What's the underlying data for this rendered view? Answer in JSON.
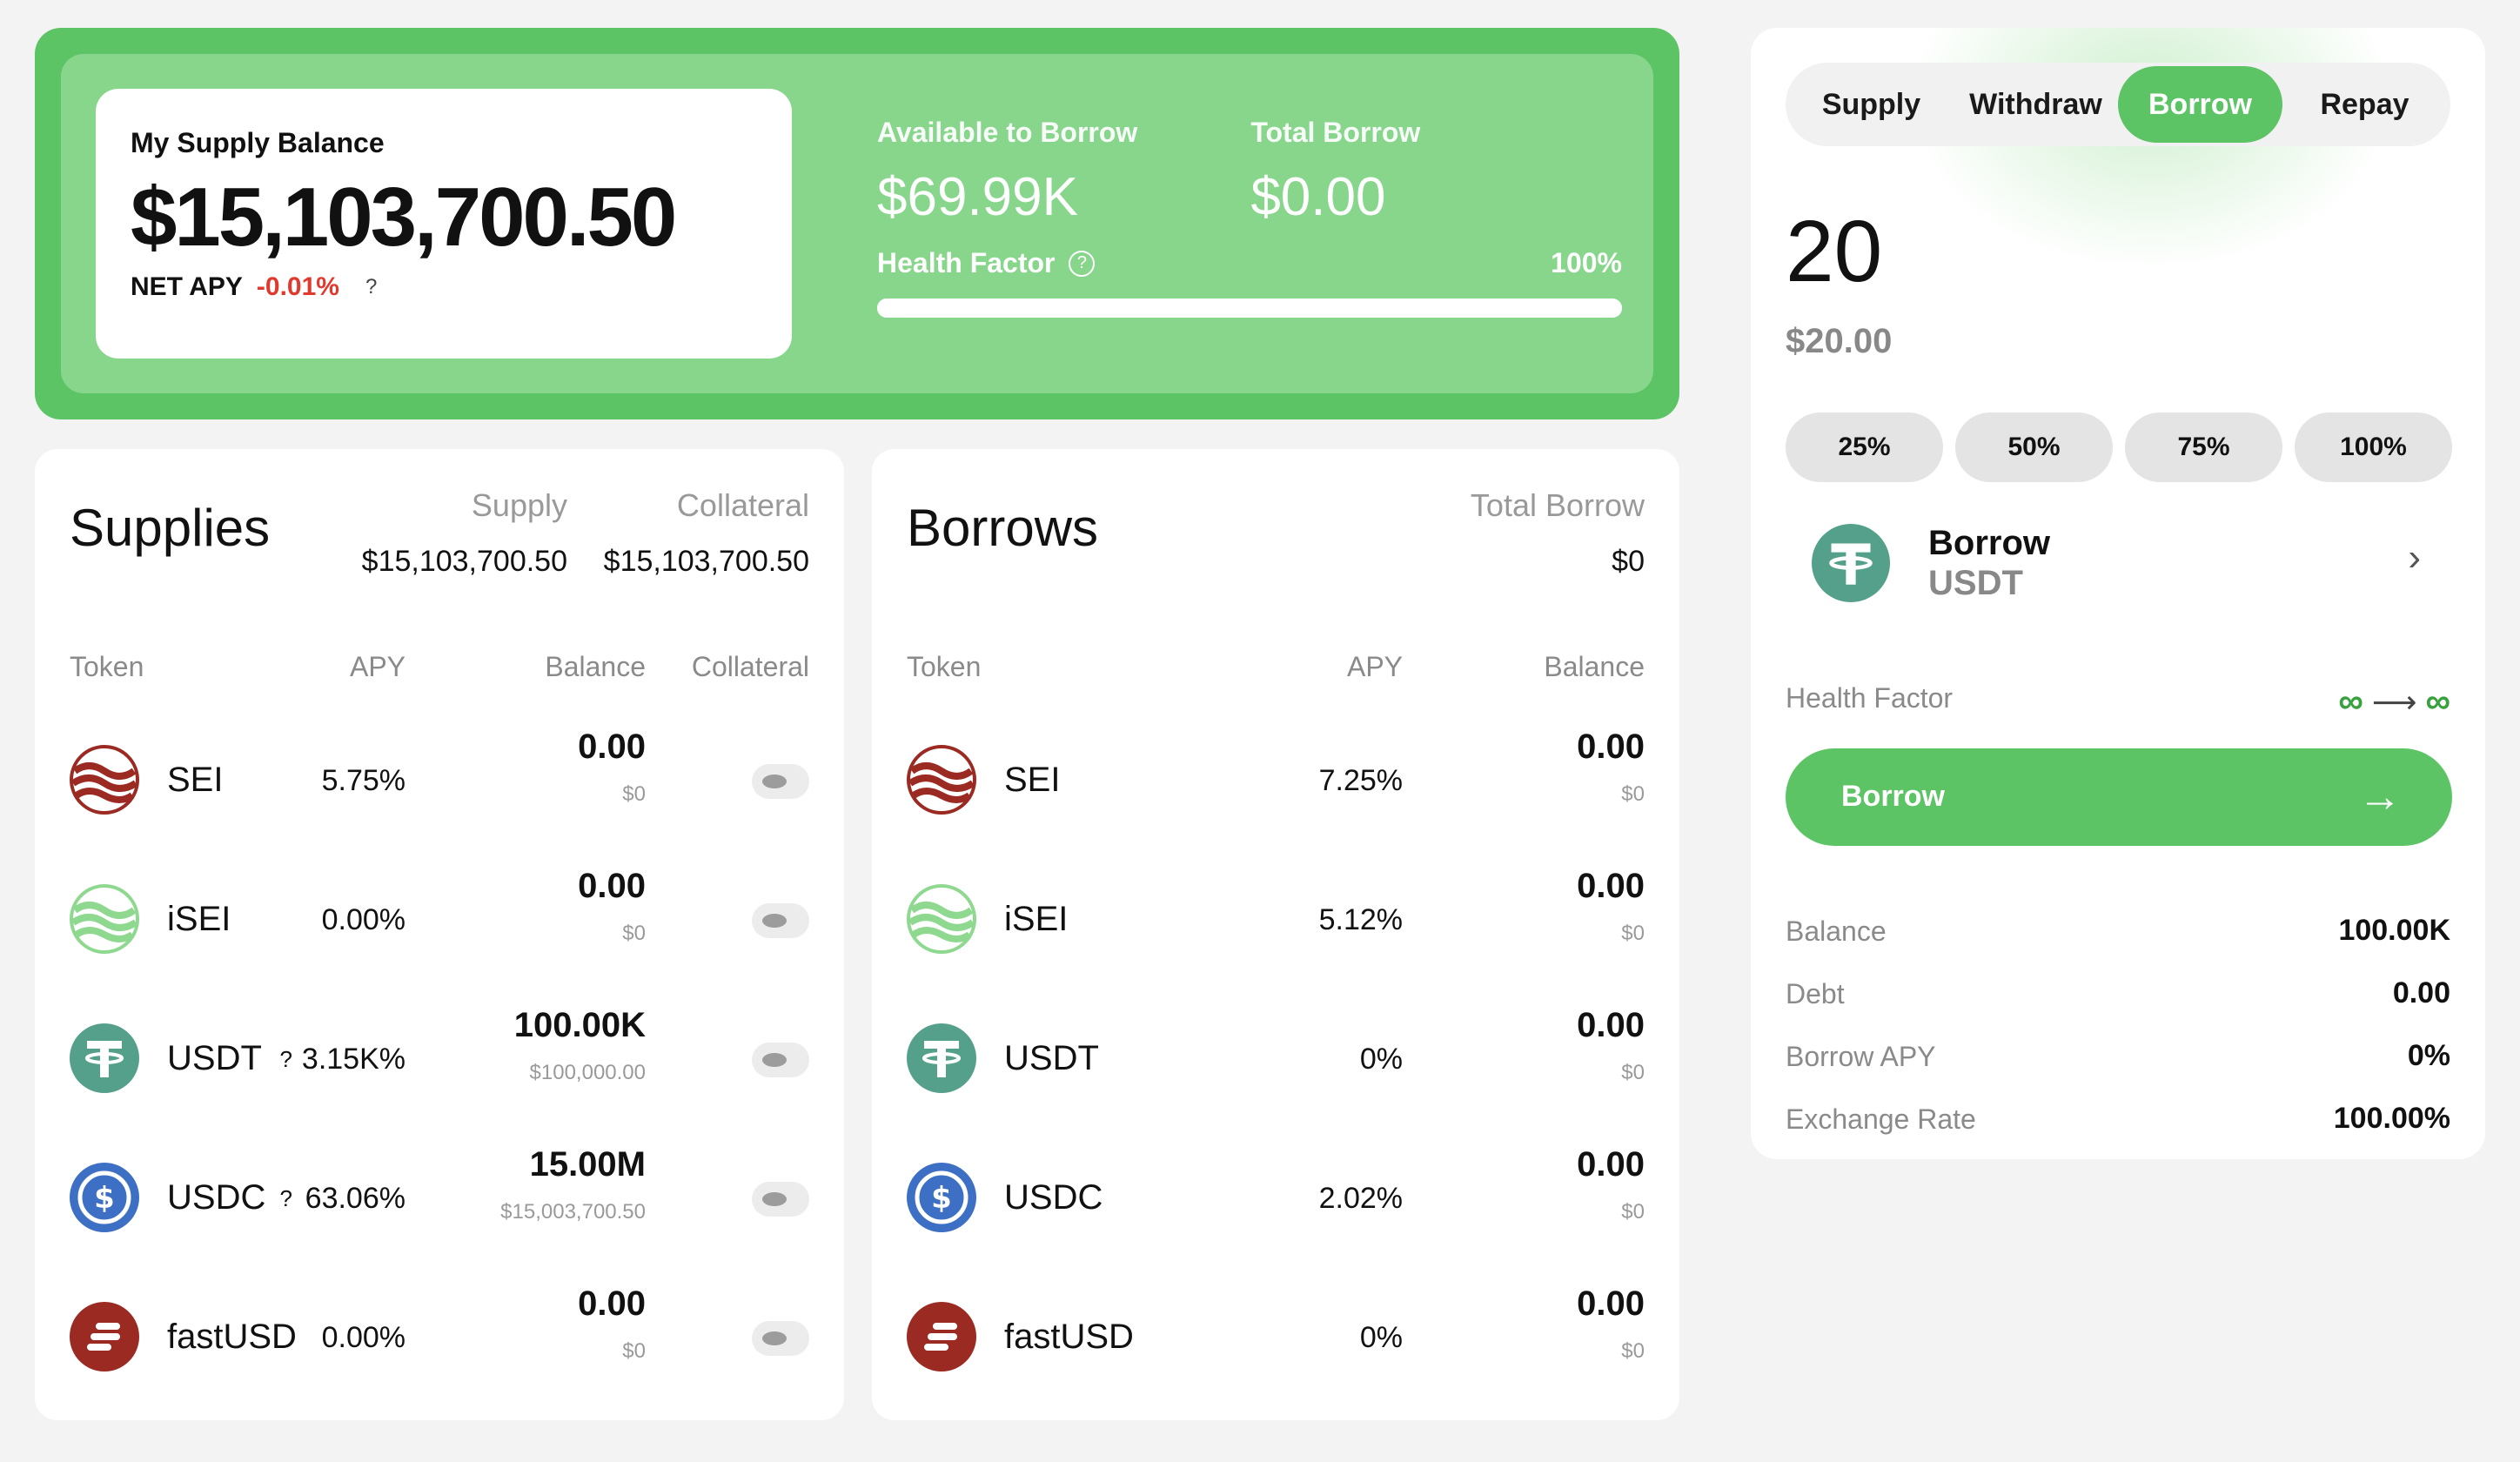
{
  "hero": {
    "supply_label": "My Supply Balance",
    "supply_value": "$15,103,700.50",
    "net_apy_label": "NET APY",
    "net_apy_value": "-0.01%",
    "net_apy_help": "?",
    "available_label": "Available to Borrow",
    "available_value": "$69.99K",
    "total_borrow_label": "Total Borrow",
    "total_borrow_value": "$0.00",
    "health_label": "Health Factor",
    "health_help": "?",
    "health_value": "100%",
    "health_fraction": 1.0
  },
  "supplies": {
    "title": "Supplies",
    "supply_label": "Supply",
    "supply_value": "$15,103,700.50",
    "collateral_label": "Collateral",
    "collateral_value": "$15,103,700.50",
    "headers": {
      "token": "Token",
      "apy": "APY",
      "balance": "Balance",
      "collateral": "Collateral"
    },
    "rows": [
      {
        "token": "SEI",
        "icon": "sei-icon",
        "apy": "5.75%",
        "q": "",
        "balance": "0.00",
        "usd": "$0"
      },
      {
        "token": "iSEI",
        "icon": "isei-icon",
        "apy": "0.00%",
        "q": "",
        "balance": "0.00",
        "usd": "$0"
      },
      {
        "token": "USDT",
        "icon": "usdt-icon",
        "apy": "3.15K%",
        "q": "?",
        "balance": "100.00K",
        "usd": "$100,000.00"
      },
      {
        "token": "USDC",
        "icon": "usdc-icon",
        "apy": "63.06%",
        "q": "?",
        "balance": "15.00M",
        "usd": "$15,003,700.50"
      },
      {
        "token": "fastUSD",
        "icon": "fastusd-icon",
        "apy": "0.00%",
        "q": "",
        "balance": "0.00",
        "usd": "$0"
      }
    ]
  },
  "borrows": {
    "title": "Borrows",
    "total_label": "Total Borrow",
    "total_value": "$0",
    "headers": {
      "token": "Token",
      "apy": "APY",
      "balance": "Balance"
    },
    "rows": [
      {
        "token": "SEI",
        "icon": "sei-icon",
        "apy": "7.25%",
        "balance": "0.00",
        "usd": "$0"
      },
      {
        "token": "iSEI",
        "icon": "isei-icon",
        "apy": "5.12%",
        "balance": "0.00",
        "usd": "$0"
      },
      {
        "token": "USDT",
        "icon": "usdt-icon",
        "apy": "0%",
        "balance": "0.00",
        "usd": "$0"
      },
      {
        "token": "USDC",
        "icon": "usdc-icon",
        "apy": "2.02%",
        "balance": "0.00",
        "usd": "$0"
      },
      {
        "token": "fastUSD",
        "icon": "fastusd-icon",
        "apy": "0%",
        "balance": "0.00",
        "usd": "$0"
      }
    ]
  },
  "action": {
    "tabs": [
      "Supply",
      "Withdraw",
      "Borrow",
      "Repay"
    ],
    "active_tab": "Borrow",
    "amount": "20",
    "amount_usd": "$20.00",
    "percent_buttons": [
      "25%",
      "50%",
      "75%",
      "100%"
    ],
    "asset_action": "Borrow",
    "asset_symbol": "USDT",
    "health_label": "Health Factor",
    "health_from": "∞",
    "health_to": "∞",
    "button_label": "Borrow",
    "info": [
      {
        "label": "Balance",
        "value": "100.00K"
      },
      {
        "label": "Debt",
        "value": "0.00"
      },
      {
        "label": "Borrow APY",
        "value": "0%"
      },
      {
        "label": "Exchange Rate",
        "value": "100.00%"
      }
    ]
  },
  "colors": {
    "accent": "#5dc466",
    "accent_light": "#87d68c",
    "negative": "#e03a2f",
    "sei": "#9b2a22",
    "isei": "#8ed88f",
    "usdt": "#55a08a",
    "usdc": "#3d6fc4",
    "fastusd": "#9b2a22"
  }
}
